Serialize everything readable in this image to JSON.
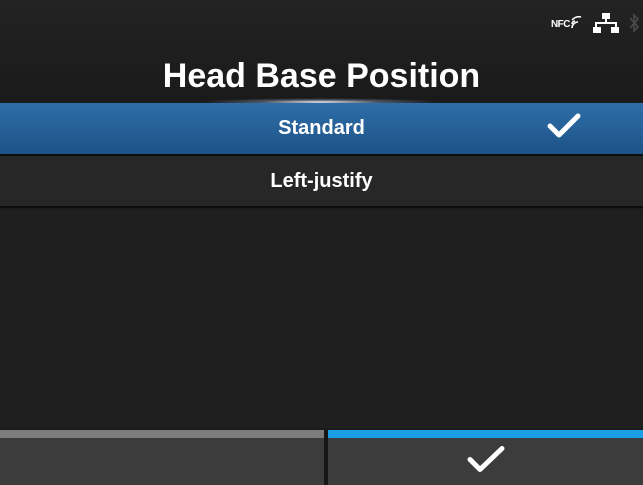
{
  "header": {
    "title": "Head Base Position",
    "status": {
      "nfc_label": "NFC"
    }
  },
  "options": [
    {
      "label": "Standard",
      "selected": true
    },
    {
      "label": "Left-justify",
      "selected": false
    }
  ],
  "footer": {
    "left_button": {
      "icon": "blank"
    },
    "right_button": {
      "icon": "check-icon"
    }
  },
  "colors": {
    "selected_row": "#2a679f",
    "accent_bar": "#1a9ee6",
    "inactive_bar": "#7d7d7d"
  }
}
